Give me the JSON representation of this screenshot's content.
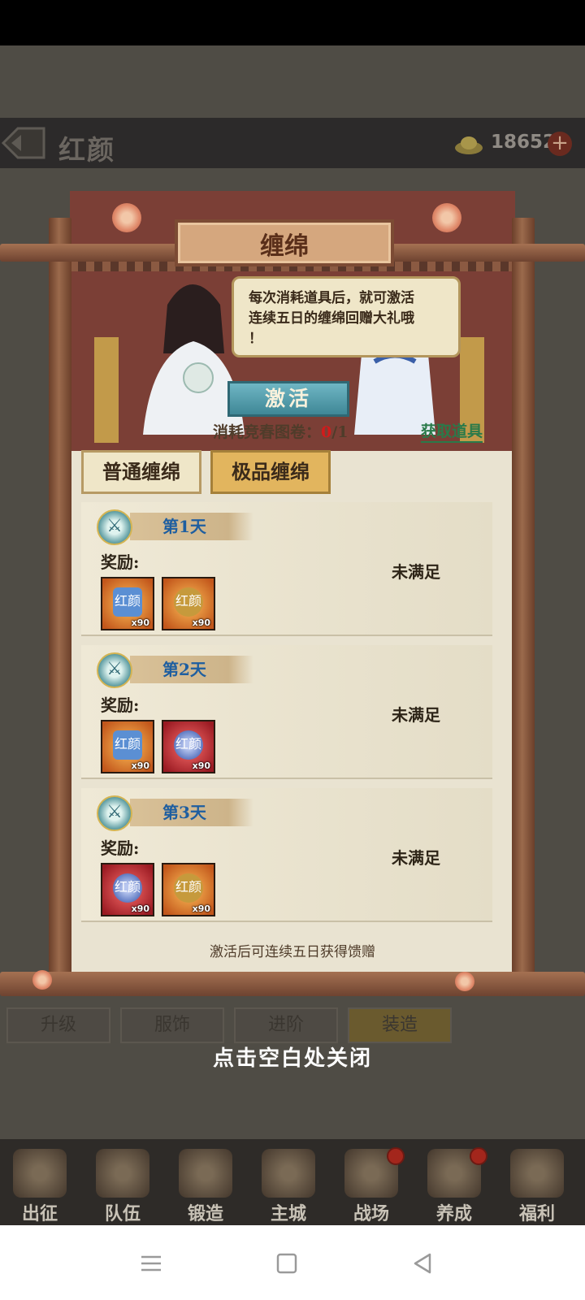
{
  "header": {
    "title": "红颜",
    "currency_value": "18652",
    "plus_label": "+"
  },
  "background_tabs": [
    "升级",
    "服饰",
    "进阶",
    "装造"
  ],
  "modal": {
    "title": "缠绵",
    "speech_lines": [
      "每次消耗道具后，就可激活",
      "连续五日的缠绵回赠大礼哦",
      "！"
    ],
    "activate_label": "激活",
    "consume_label": "消耗竞春图卷：",
    "consume_have": "0",
    "consume_total": "/1",
    "get_item_link": "获取道具",
    "tabs": [
      {
        "label": "普通缠绵",
        "selected": false
      },
      {
        "label": "极品缠绵",
        "selected": true
      }
    ],
    "days": [
      {
        "label": "第1天",
        "reward_label": "奖励:",
        "status": "未满足",
        "items": [
          {
            "bg": "orange",
            "glyph": "blue-gem",
            "glyph_text": "红颜",
            "qty": "x90"
          },
          {
            "bg": "orange",
            "glyph": "gold-coin",
            "glyph_text": "红颜",
            "qty": "x90"
          }
        ]
      },
      {
        "label": "第2天",
        "reward_label": "奖励:",
        "status": "未满足",
        "items": [
          {
            "bg": "orange",
            "glyph": "blue-gem",
            "glyph_text": "红颜",
            "qty": "x90"
          },
          {
            "bg": "red",
            "glyph": "blue-sphere",
            "glyph_text": "红颜",
            "qty": "x90"
          }
        ]
      },
      {
        "label": "第3天",
        "reward_label": "奖励:",
        "status": "未满足",
        "items": [
          {
            "bg": "red",
            "glyph": "blue-sphere",
            "glyph_text": "红颜",
            "qty": "x90"
          },
          {
            "bg": "orange",
            "glyph": "gold-coin",
            "glyph_text": "红颜",
            "qty": "x90"
          }
        ]
      }
    ],
    "footer_note": "激活后可连续五日获得馈赠"
  },
  "close_hint": "点击空白处关闭",
  "bottom_nav": [
    {
      "label": "出征",
      "badge": false
    },
    {
      "label": "队伍",
      "badge": false
    },
    {
      "label": "锻造",
      "badge": false
    },
    {
      "label": "主城",
      "badge": false
    },
    {
      "label": "战场",
      "badge": true
    },
    {
      "label": "养成",
      "badge": true
    },
    {
      "label": "福利",
      "badge": false
    }
  ],
  "system_nav": [
    "menu",
    "home",
    "back"
  ],
  "colors": {
    "accent_teal": "#3f8796",
    "premium_gold": "#e2b55e",
    "warning_red": "#d11b1b",
    "link_green": "#2a7a4a"
  }
}
